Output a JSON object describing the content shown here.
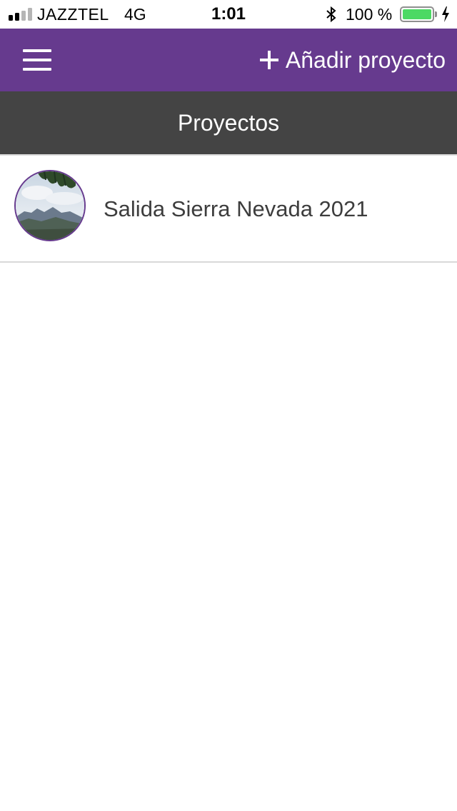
{
  "status_bar": {
    "carrier": "JAZZTEL",
    "network": "4G",
    "time": "1:01",
    "battery_percent": "100 %",
    "battery_level": 1.0,
    "signal_bars_active": 2,
    "signal_bars_total": 4,
    "icons": [
      "signal-icon",
      "bluetooth-icon",
      "battery-icon",
      "charging-icon"
    ]
  },
  "app_bar": {
    "menu_icon": "hamburger-menu-icon",
    "add_icon": "plus-icon",
    "add_label": "Añadir proyecto",
    "color": "#663a8e"
  },
  "section": {
    "title": "Proyectos",
    "color": "#444444"
  },
  "projects": [
    {
      "name": "Salida Sierra Nevada 2021",
      "thumbnail": "mountain-landscape-photo"
    }
  ]
}
